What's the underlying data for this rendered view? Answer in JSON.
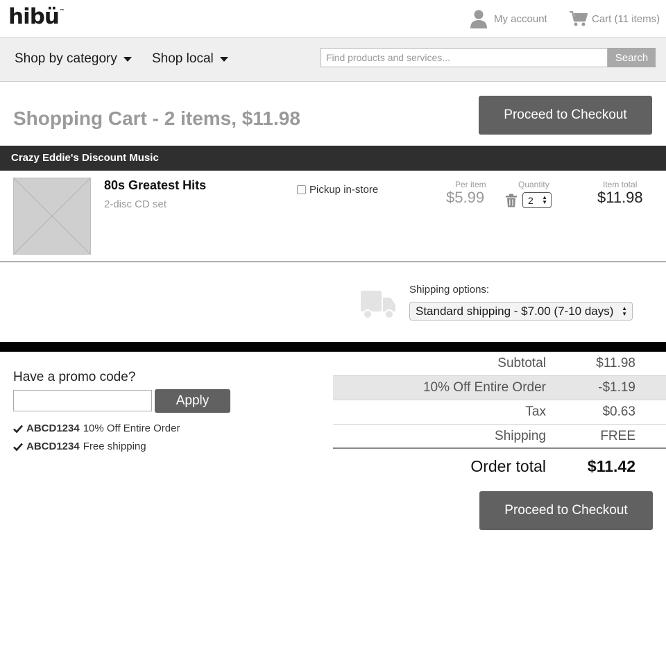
{
  "header": {
    "logo": "hibü",
    "logo_tm": "™",
    "account_label": "My account",
    "cart_label": "Cart (11 items)"
  },
  "nav": {
    "shop_category": "Shop by category",
    "shop_local": "Shop local",
    "search_placeholder": "Find products and services...",
    "search_button": "Search"
  },
  "cart": {
    "title": "Shopping Cart - 2 items, $11.98",
    "checkout_label": "Proceed to Checkout",
    "seller": "Crazy Eddie's Discount Music",
    "item": {
      "name": "80s Greatest Hits",
      "description": "2-disc CD set",
      "pickup_label": "Pickup in-store",
      "per_item_label": "Per item",
      "per_item_price": "$5.99",
      "quantity_label": "Quantity",
      "quantity": "2",
      "item_total_label": "Item total",
      "item_total": "$11.98"
    },
    "shipping": {
      "label": "Shipping options:",
      "selected": "Standard shipping - $7.00 (7-10 days)"
    }
  },
  "promo": {
    "label": "Have a promo code?",
    "apply_label": "Apply",
    "codes": [
      {
        "code": "ABCD1234",
        "description": "10% Off Entire Order"
      },
      {
        "code": "ABCD1234",
        "description": "Free shipping"
      }
    ]
  },
  "summary": {
    "rows": [
      {
        "label": "Subtotal",
        "value": "$11.98"
      },
      {
        "label": "10% Off Entire Order",
        "value": "-$1.19"
      },
      {
        "label": "Tax",
        "value": "$0.63"
      },
      {
        "label": "Shipping",
        "value": "FREE"
      }
    ],
    "total_label": "Order total",
    "total_value": "$11.42"
  },
  "colors": {
    "button": "#616161",
    "seller_bar": "#2f2f2f",
    "nav_bg": "#efefef"
  }
}
